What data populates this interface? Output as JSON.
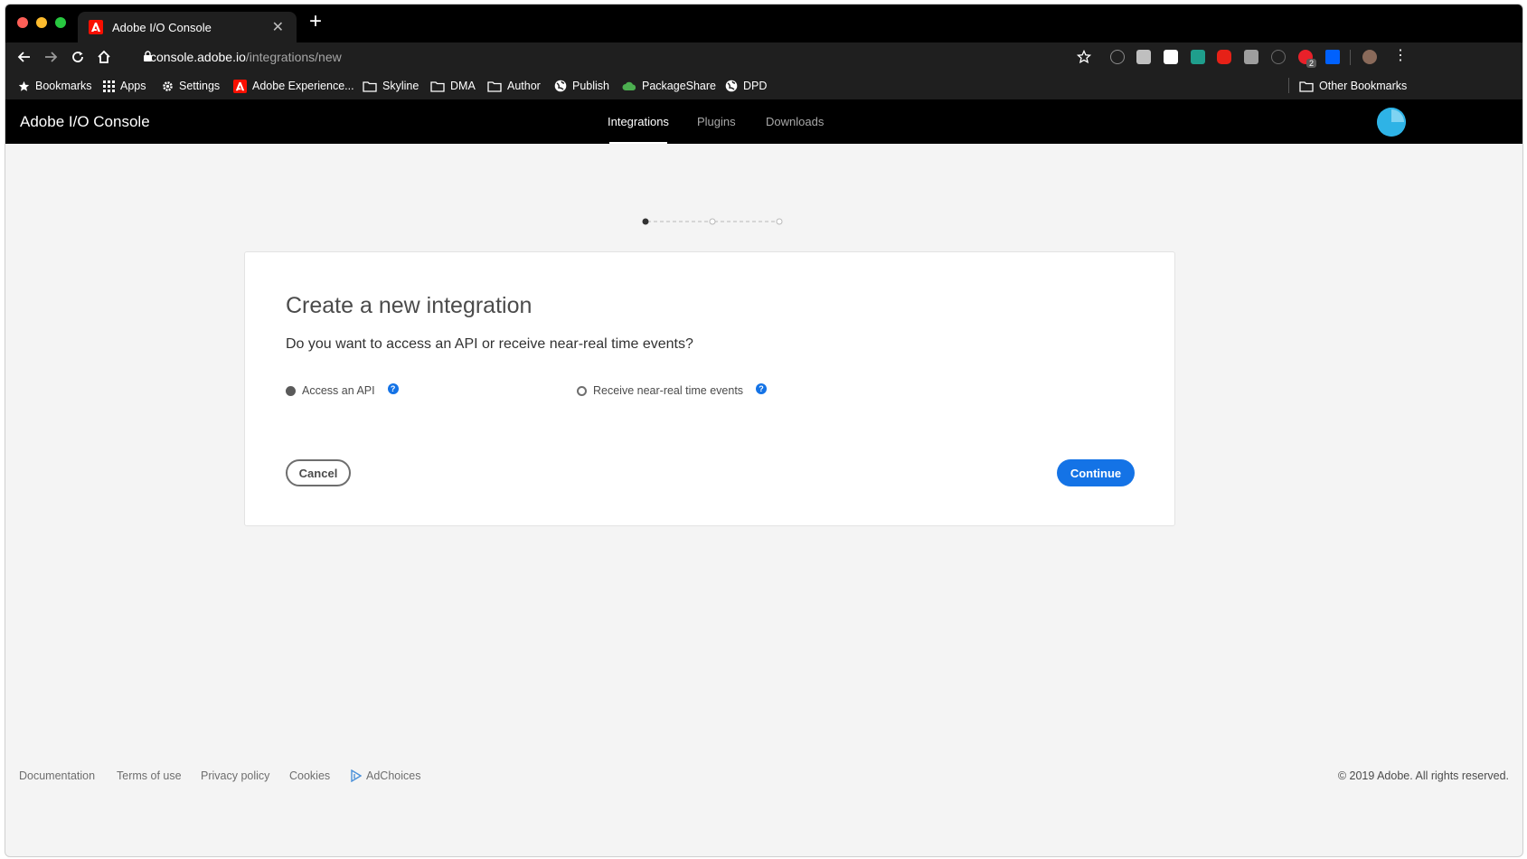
{
  "browser": {
    "tab_title": "Adobe I/O Console",
    "url_host": "console.adobe.io",
    "url_path": "/integrations/new",
    "bookmarks": [
      {
        "label": "Bookmarks",
        "icon": "star-icon"
      },
      {
        "label": "Apps",
        "icon": "apps-grid-icon"
      },
      {
        "label": "Settings",
        "icon": "gear-icon"
      },
      {
        "label": "Adobe Experience...",
        "icon": "adobe-logo-icon"
      },
      {
        "label": "Skyline",
        "icon": "folder-icon"
      },
      {
        "label": "DMA",
        "icon": "folder-icon"
      },
      {
        "label": "Author",
        "icon": "folder-icon"
      },
      {
        "label": "Publish",
        "icon": "globe-icon"
      },
      {
        "label": "PackageShare",
        "icon": "cloud-icon"
      },
      {
        "label": "DPD",
        "icon": "globe-icon"
      }
    ],
    "other_bookmarks": "Other Bookmarks",
    "extension_badge": "2"
  },
  "app": {
    "brand": "Adobe I/O Console",
    "nav": [
      {
        "label": "Integrations",
        "active": true
      },
      {
        "label": "Plugins",
        "active": false
      },
      {
        "label": "Downloads",
        "active": false
      }
    ]
  },
  "stepper": {
    "steps": 3,
    "current": 1
  },
  "card": {
    "title": "Create a new integration",
    "question": "Do you want to access an API or receive near-real time events?",
    "options": [
      {
        "label": "Access an API",
        "selected": true
      },
      {
        "label": "Receive near-real time events",
        "selected": false
      }
    ],
    "help_glyph": "?",
    "cancel_label": "Cancel",
    "continue_label": "Continue"
  },
  "footer": {
    "links": [
      "Documentation",
      "Terms of use",
      "Privacy policy",
      "Cookies",
      "AdChoices"
    ],
    "copyright": "© 2019 Adobe. All rights reserved."
  },
  "colors": {
    "accent": "#1473e6",
    "header_bg": "#000000",
    "page_bg": "#f4f4f4"
  }
}
